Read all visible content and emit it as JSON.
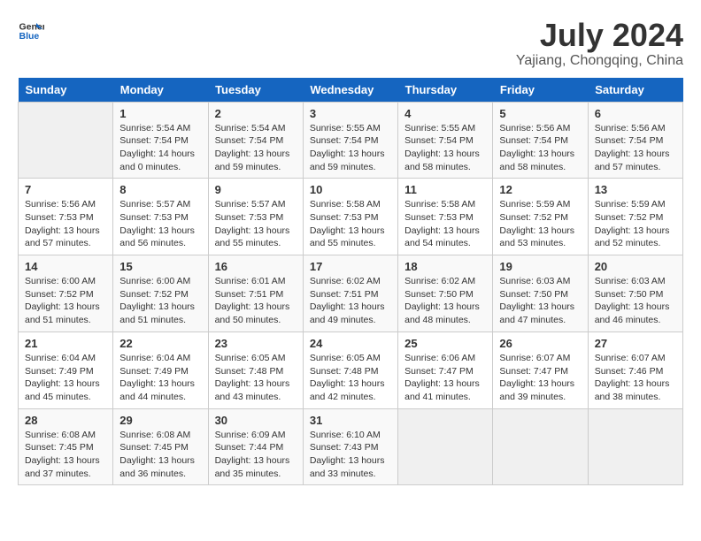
{
  "logo": {
    "line1": "General",
    "line2": "Blue"
  },
  "title": "July 2024",
  "subtitle": "Yajiang, Chongqing, China",
  "weekdays": [
    "Sunday",
    "Monday",
    "Tuesday",
    "Wednesday",
    "Thursday",
    "Friday",
    "Saturday"
  ],
  "weeks": [
    [
      {
        "day": "",
        "sunrise": "",
        "sunset": "",
        "daylight": ""
      },
      {
        "day": "1",
        "sunrise": "Sunrise: 5:54 AM",
        "sunset": "Sunset: 7:54 PM",
        "daylight": "Daylight: 14 hours and 0 minutes."
      },
      {
        "day": "2",
        "sunrise": "Sunrise: 5:54 AM",
        "sunset": "Sunset: 7:54 PM",
        "daylight": "Daylight: 13 hours and 59 minutes."
      },
      {
        "day": "3",
        "sunrise": "Sunrise: 5:55 AM",
        "sunset": "Sunset: 7:54 PM",
        "daylight": "Daylight: 13 hours and 59 minutes."
      },
      {
        "day": "4",
        "sunrise": "Sunrise: 5:55 AM",
        "sunset": "Sunset: 7:54 PM",
        "daylight": "Daylight: 13 hours and 58 minutes."
      },
      {
        "day": "5",
        "sunrise": "Sunrise: 5:56 AM",
        "sunset": "Sunset: 7:54 PM",
        "daylight": "Daylight: 13 hours and 58 minutes."
      },
      {
        "day": "6",
        "sunrise": "Sunrise: 5:56 AM",
        "sunset": "Sunset: 7:54 PM",
        "daylight": "Daylight: 13 hours and 57 minutes."
      }
    ],
    [
      {
        "day": "7",
        "sunrise": "Sunrise: 5:56 AM",
        "sunset": "Sunset: 7:53 PM",
        "daylight": "Daylight: 13 hours and 57 minutes."
      },
      {
        "day": "8",
        "sunrise": "Sunrise: 5:57 AM",
        "sunset": "Sunset: 7:53 PM",
        "daylight": "Daylight: 13 hours and 56 minutes."
      },
      {
        "day": "9",
        "sunrise": "Sunrise: 5:57 AM",
        "sunset": "Sunset: 7:53 PM",
        "daylight": "Daylight: 13 hours and 55 minutes."
      },
      {
        "day": "10",
        "sunrise": "Sunrise: 5:58 AM",
        "sunset": "Sunset: 7:53 PM",
        "daylight": "Daylight: 13 hours and 55 minutes."
      },
      {
        "day": "11",
        "sunrise": "Sunrise: 5:58 AM",
        "sunset": "Sunset: 7:53 PM",
        "daylight": "Daylight: 13 hours and 54 minutes."
      },
      {
        "day": "12",
        "sunrise": "Sunrise: 5:59 AM",
        "sunset": "Sunset: 7:52 PM",
        "daylight": "Daylight: 13 hours and 53 minutes."
      },
      {
        "day": "13",
        "sunrise": "Sunrise: 5:59 AM",
        "sunset": "Sunset: 7:52 PM",
        "daylight": "Daylight: 13 hours and 52 minutes."
      }
    ],
    [
      {
        "day": "14",
        "sunrise": "Sunrise: 6:00 AM",
        "sunset": "Sunset: 7:52 PM",
        "daylight": "Daylight: 13 hours and 51 minutes."
      },
      {
        "day": "15",
        "sunrise": "Sunrise: 6:00 AM",
        "sunset": "Sunset: 7:52 PM",
        "daylight": "Daylight: 13 hours and 51 minutes."
      },
      {
        "day": "16",
        "sunrise": "Sunrise: 6:01 AM",
        "sunset": "Sunset: 7:51 PM",
        "daylight": "Daylight: 13 hours and 50 minutes."
      },
      {
        "day": "17",
        "sunrise": "Sunrise: 6:02 AM",
        "sunset": "Sunset: 7:51 PM",
        "daylight": "Daylight: 13 hours and 49 minutes."
      },
      {
        "day": "18",
        "sunrise": "Sunrise: 6:02 AM",
        "sunset": "Sunset: 7:50 PM",
        "daylight": "Daylight: 13 hours and 48 minutes."
      },
      {
        "day": "19",
        "sunrise": "Sunrise: 6:03 AM",
        "sunset": "Sunset: 7:50 PM",
        "daylight": "Daylight: 13 hours and 47 minutes."
      },
      {
        "day": "20",
        "sunrise": "Sunrise: 6:03 AM",
        "sunset": "Sunset: 7:50 PM",
        "daylight": "Daylight: 13 hours and 46 minutes."
      }
    ],
    [
      {
        "day": "21",
        "sunrise": "Sunrise: 6:04 AM",
        "sunset": "Sunset: 7:49 PM",
        "daylight": "Daylight: 13 hours and 45 minutes."
      },
      {
        "day": "22",
        "sunrise": "Sunrise: 6:04 AM",
        "sunset": "Sunset: 7:49 PM",
        "daylight": "Daylight: 13 hours and 44 minutes."
      },
      {
        "day": "23",
        "sunrise": "Sunrise: 6:05 AM",
        "sunset": "Sunset: 7:48 PM",
        "daylight": "Daylight: 13 hours and 43 minutes."
      },
      {
        "day": "24",
        "sunrise": "Sunrise: 6:05 AM",
        "sunset": "Sunset: 7:48 PM",
        "daylight": "Daylight: 13 hours and 42 minutes."
      },
      {
        "day": "25",
        "sunrise": "Sunrise: 6:06 AM",
        "sunset": "Sunset: 7:47 PM",
        "daylight": "Daylight: 13 hours and 41 minutes."
      },
      {
        "day": "26",
        "sunrise": "Sunrise: 6:07 AM",
        "sunset": "Sunset: 7:47 PM",
        "daylight": "Daylight: 13 hours and 39 minutes."
      },
      {
        "day": "27",
        "sunrise": "Sunrise: 6:07 AM",
        "sunset": "Sunset: 7:46 PM",
        "daylight": "Daylight: 13 hours and 38 minutes."
      }
    ],
    [
      {
        "day": "28",
        "sunrise": "Sunrise: 6:08 AM",
        "sunset": "Sunset: 7:45 PM",
        "daylight": "Daylight: 13 hours and 37 minutes."
      },
      {
        "day": "29",
        "sunrise": "Sunrise: 6:08 AM",
        "sunset": "Sunset: 7:45 PM",
        "daylight": "Daylight: 13 hours and 36 minutes."
      },
      {
        "day": "30",
        "sunrise": "Sunrise: 6:09 AM",
        "sunset": "Sunset: 7:44 PM",
        "daylight": "Daylight: 13 hours and 35 minutes."
      },
      {
        "day": "31",
        "sunrise": "Sunrise: 6:10 AM",
        "sunset": "Sunset: 7:43 PM",
        "daylight": "Daylight: 13 hours and 33 minutes."
      },
      {
        "day": "",
        "sunrise": "",
        "sunset": "",
        "daylight": ""
      },
      {
        "day": "",
        "sunrise": "",
        "sunset": "",
        "daylight": ""
      },
      {
        "day": "",
        "sunrise": "",
        "sunset": "",
        "daylight": ""
      }
    ]
  ]
}
